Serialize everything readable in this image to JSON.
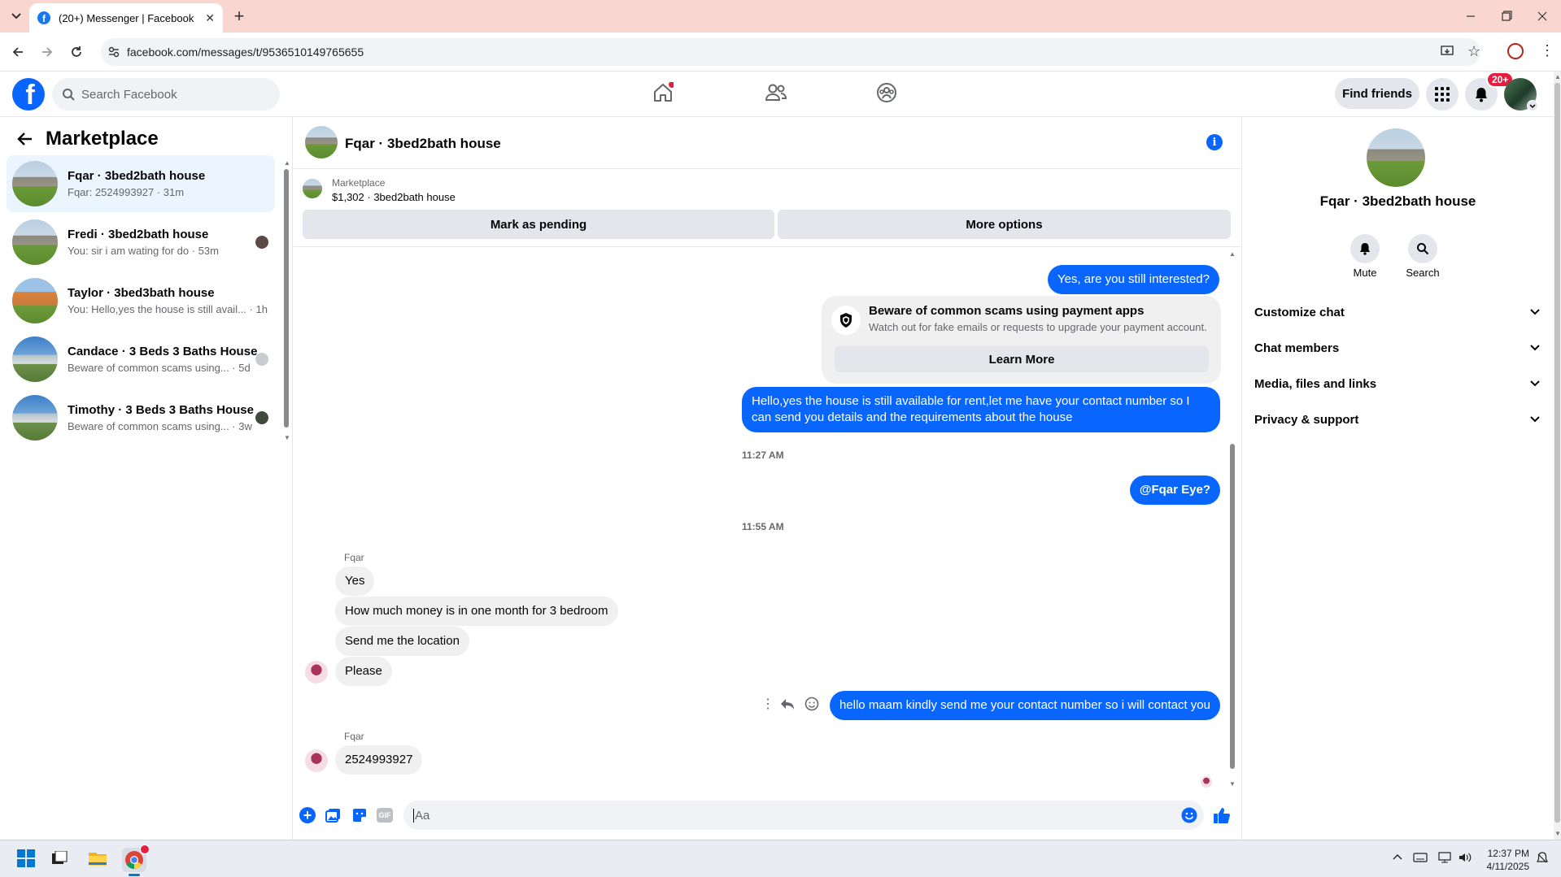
{
  "browser": {
    "tab_title": "(20+) Messenger | Facebook",
    "url": "facebook.com/messages/t/9536510149765655"
  },
  "fb": {
    "logo": "f",
    "search_placeholder": "Search Facebook",
    "find_friends": "Find friends",
    "notification_badge": "20+"
  },
  "sidebar": {
    "title": "Marketplace",
    "conversations": [
      {
        "name": "Fqar · 3bed2bath house",
        "preview": "Fqar: 2524993927 · 31m"
      },
      {
        "name": "Fredi · 3bed2bath house",
        "preview": "You: sir i am wating for do · 53m"
      },
      {
        "name": "Taylor · 3bed3bath house",
        "preview": "You: Hello,yes the house is still avail... · 1h"
      },
      {
        "name": "Candace · 3 Beds 3 Baths House",
        "preview": "Beware of common scams using... · 5d"
      },
      {
        "name": "Timothy · 3 Beds 3 Baths House",
        "preview": "Beware of common scams using... · 3w"
      }
    ]
  },
  "chat": {
    "title": "Fqar · 3bed2bath house",
    "marketplace_label": "Marketplace",
    "listing": "$1,302 · 3bed2bath house",
    "mark_pending": "Mark as pending",
    "more_options": "More options",
    "msg_still_interested": "Yes, are you still interested?",
    "scam_title": "Beware of common scams using payment apps",
    "scam_body": "Watch out for fake emails or requests to upgrade your payment account.",
    "learn_more": "Learn More",
    "msg_hello_line1": "Hello,yes the house is still available for rent,let me have your contact number  so I",
    "msg_hello_line2": "can send you details and the requirements about the house",
    "time_1": "11:27 AM",
    "msg_mention": "@Fqar Eye?",
    "time_2": "11:55 AM",
    "sender_1": "Fqar",
    "in_1": "Yes",
    "in_2": "How much money is in one month for 3 bedroom",
    "in_3": "Send me the location",
    "in_4": "Please",
    "out_contact": "hello maam kindly send me your contact number so i will contact you",
    "sender_2": "Fqar",
    "in_5": "2524993927",
    "composer_placeholder": "Aa"
  },
  "right_panel": {
    "name": "Fqar · 3bed2bath house",
    "mute": "Mute",
    "search": "Search",
    "sections": [
      "Customize chat",
      "Chat members",
      "Media, files and links",
      "Privacy & support"
    ]
  },
  "taskbar": {
    "time": "12:37 PM",
    "date": "4/11/2025"
  },
  "colors": {
    "accent": "#0866ff",
    "tab_bar": "#f9d6cf",
    "active_conv": "#ebf5ff"
  }
}
